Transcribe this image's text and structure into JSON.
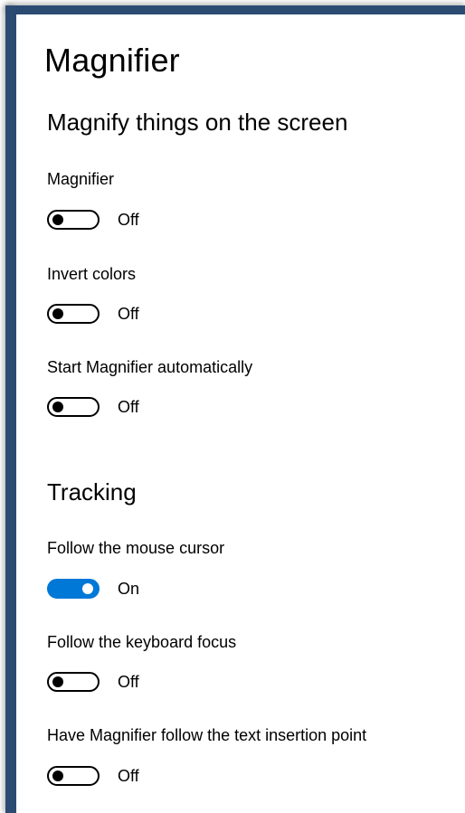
{
  "page": {
    "title": "Magnifier"
  },
  "sections": {
    "magnify": {
      "heading": "Magnify things on the screen",
      "settings": [
        {
          "label": "Magnifier",
          "state_text": "Off",
          "on": false
        },
        {
          "label": "Invert colors",
          "state_text": "Off",
          "on": false
        },
        {
          "label": "Start Magnifier automatically",
          "state_text": "Off",
          "on": false
        }
      ]
    },
    "tracking": {
      "heading": "Tracking",
      "settings": [
        {
          "label": "Follow the mouse cursor",
          "state_text": "On",
          "on": true
        },
        {
          "label": "Follow the keyboard focus",
          "state_text": "Off",
          "on": false
        },
        {
          "label": "Have Magnifier follow the text insertion point",
          "state_text": "Off",
          "on": false
        }
      ]
    }
  },
  "colors": {
    "accent": "#0078d7",
    "window_border": "#2b4b73"
  }
}
